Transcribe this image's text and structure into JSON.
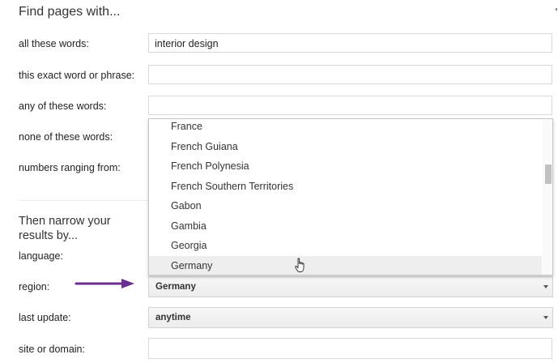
{
  "section1": {
    "heading": "Find pages with..."
  },
  "rows": {
    "all_words": {
      "label": "all these words:",
      "value": "interior design"
    },
    "exact_phrase": {
      "label": "this exact word or phrase:",
      "value": ""
    },
    "any_words": {
      "label": "any of these words:",
      "value": ""
    },
    "none_words": {
      "label": "none of these words:"
    },
    "numbers": {
      "label": "numbers ranging from:"
    }
  },
  "section2": {
    "heading": "Then narrow your results by..."
  },
  "narrow": {
    "language": {
      "label": "language:"
    },
    "region": {
      "label": "region:",
      "selected": "Germany"
    },
    "last_update": {
      "label": "last update:",
      "selected": "anytime"
    },
    "site": {
      "label": "site or domain:",
      "value": ""
    }
  },
  "dropdown": {
    "options": [
      "France",
      "French Guiana",
      "French Polynesia",
      "French Southern Territories",
      "Gabon",
      "Gambia",
      "Georgia",
      "Germany"
    ],
    "highlighted": "Germany"
  },
  "icons": {
    "caret": "chevron-down-icon",
    "cursor": "hand-cursor-icon",
    "annotation": "arrow-right-icon"
  },
  "colors": {
    "annotation_arrow": "#6b2f8f",
    "highlight": "#eeeeee"
  }
}
